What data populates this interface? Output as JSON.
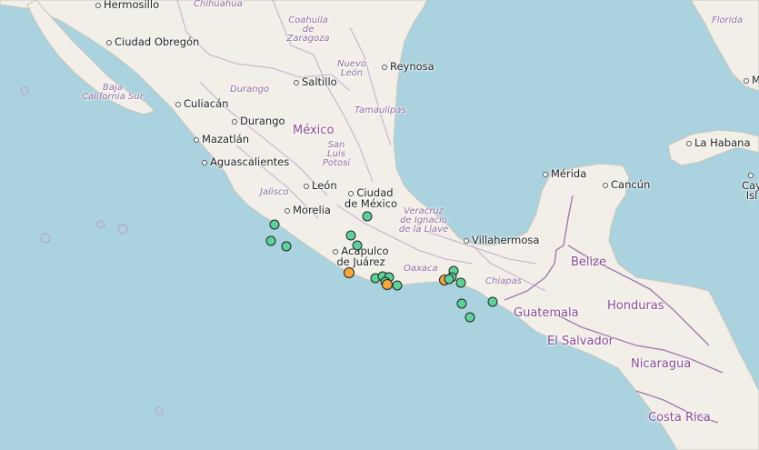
{
  "map": {
    "colors": {
      "water": "#aad3df",
      "land": "#f2efe9",
      "border": "#b99bc4",
      "green_marker": "#5ed19a",
      "orange_marker": "#f5a83c"
    },
    "labels": [
      {
        "text": "Hermosillo",
        "kind": "city"
      },
      {
        "text": "Chihuahua",
        "kind": "region"
      },
      {
        "text": "Ciudad Obregón",
        "kind": "city"
      },
      {
        "text": "Coahuila de Zaragoza",
        "kind": "region"
      },
      {
        "text": "Nuevo León",
        "kind": "region"
      },
      {
        "text": "Reynosa",
        "kind": "city"
      },
      {
        "text": "Baja California Sur",
        "kind": "region"
      },
      {
        "text": "Saltillo",
        "kind": "city"
      },
      {
        "text": "Durango",
        "kind": "region"
      },
      {
        "text": "Culiacán",
        "kind": "city"
      },
      {
        "text": "Durango",
        "kind": "city"
      },
      {
        "text": "Tamaulipas",
        "kind": "region"
      },
      {
        "text": "México",
        "kind": "country"
      },
      {
        "text": "Mazatlán",
        "kind": "city"
      },
      {
        "text": "San Luis Potosí",
        "kind": "region"
      },
      {
        "text": "Aguascalientes",
        "kind": "city"
      },
      {
        "text": "León",
        "kind": "city"
      },
      {
        "text": "Jalisco",
        "kind": "region"
      },
      {
        "text": "Ciudad de México",
        "kind": "city"
      },
      {
        "text": "Morelia",
        "kind": "city"
      },
      {
        "text": "Veracruz de Ignacio de la Llave",
        "kind": "region"
      },
      {
        "text": "Acapulco de Juárez",
        "kind": "city"
      },
      {
        "text": "Oaxaca",
        "kind": "region"
      },
      {
        "text": "Villahermosa",
        "kind": "city"
      },
      {
        "text": "Chiapas",
        "kind": "region"
      },
      {
        "text": "Mérida",
        "kind": "city"
      },
      {
        "text": "Cancún",
        "kind": "city"
      },
      {
        "text": "Florida",
        "kind": "region"
      },
      {
        "text": "Mi",
        "kind": "city"
      },
      {
        "text": "La Habana",
        "kind": "city"
      },
      {
        "text": "Cay Isl",
        "kind": "city"
      },
      {
        "text": "Belize",
        "kind": "country"
      },
      {
        "text": "Guatemala",
        "kind": "country"
      },
      {
        "text": "Honduras",
        "kind": "country"
      },
      {
        "text": "El Salvador",
        "kind": "country"
      },
      {
        "text": "Nicaragua",
        "kind": "country"
      },
      {
        "text": "Costa Rica",
        "kind": "country"
      }
    ],
    "markers": [
      {
        "type": "green"
      },
      {
        "type": "green"
      },
      {
        "type": "green"
      },
      {
        "type": "green"
      },
      {
        "type": "green"
      },
      {
        "type": "green"
      },
      {
        "type": "orange"
      },
      {
        "type": "green"
      },
      {
        "type": "green"
      },
      {
        "type": "green"
      },
      {
        "type": "green"
      },
      {
        "type": "orange"
      },
      {
        "type": "green"
      },
      {
        "type": "green"
      },
      {
        "type": "orange"
      },
      {
        "type": "green"
      },
      {
        "type": "green"
      },
      {
        "type": "green"
      },
      {
        "type": "green"
      },
      {
        "type": "green"
      },
      {
        "type": "green"
      }
    ]
  }
}
